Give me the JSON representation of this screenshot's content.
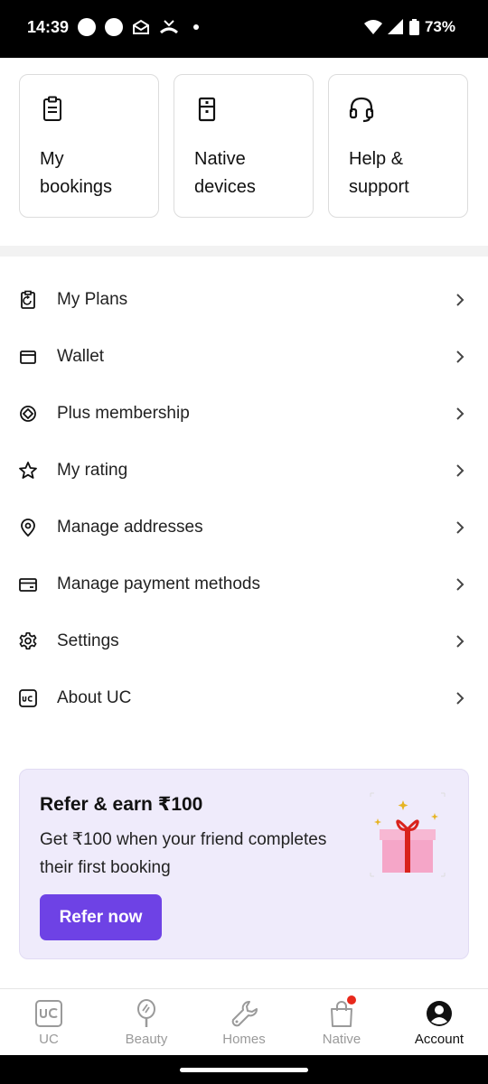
{
  "status_bar": {
    "time": "14:39",
    "battery": "73%"
  },
  "cards": [
    {
      "label": "My\nbookings",
      "icon": "clipboard-icon"
    },
    {
      "label": "Native\ndevices",
      "icon": "appliance-icon"
    },
    {
      "label": "Help &\nsupport",
      "icon": "headset-icon"
    }
  ],
  "menu": [
    {
      "label": "My Plans",
      "icon": "plans-icon"
    },
    {
      "label": "Wallet",
      "icon": "wallet-icon"
    },
    {
      "label": "Plus membership",
      "icon": "membership-icon"
    },
    {
      "label": "My rating",
      "icon": "star-icon"
    },
    {
      "label": "Manage addresses",
      "icon": "location-icon"
    },
    {
      "label": "Manage payment methods",
      "icon": "card-icon"
    },
    {
      "label": "Settings",
      "icon": "gear-icon"
    },
    {
      "label": "About UC",
      "icon": "uc-logo-icon"
    }
  ],
  "refer": {
    "title": "Refer & earn ₹100",
    "subtitle": "Get ₹100 when your friend completes their first booking",
    "button": "Refer now"
  },
  "bottom_nav": [
    {
      "label": "UC",
      "active": false
    },
    {
      "label": "Beauty",
      "active": false
    },
    {
      "label": "Homes",
      "active": false
    },
    {
      "label": "Native",
      "active": false
    },
    {
      "label": "Account",
      "active": true
    }
  ],
  "colors": {
    "accent": "#6e42e5",
    "refer_bg": "#efebfb",
    "badge": "#e8291c"
  }
}
